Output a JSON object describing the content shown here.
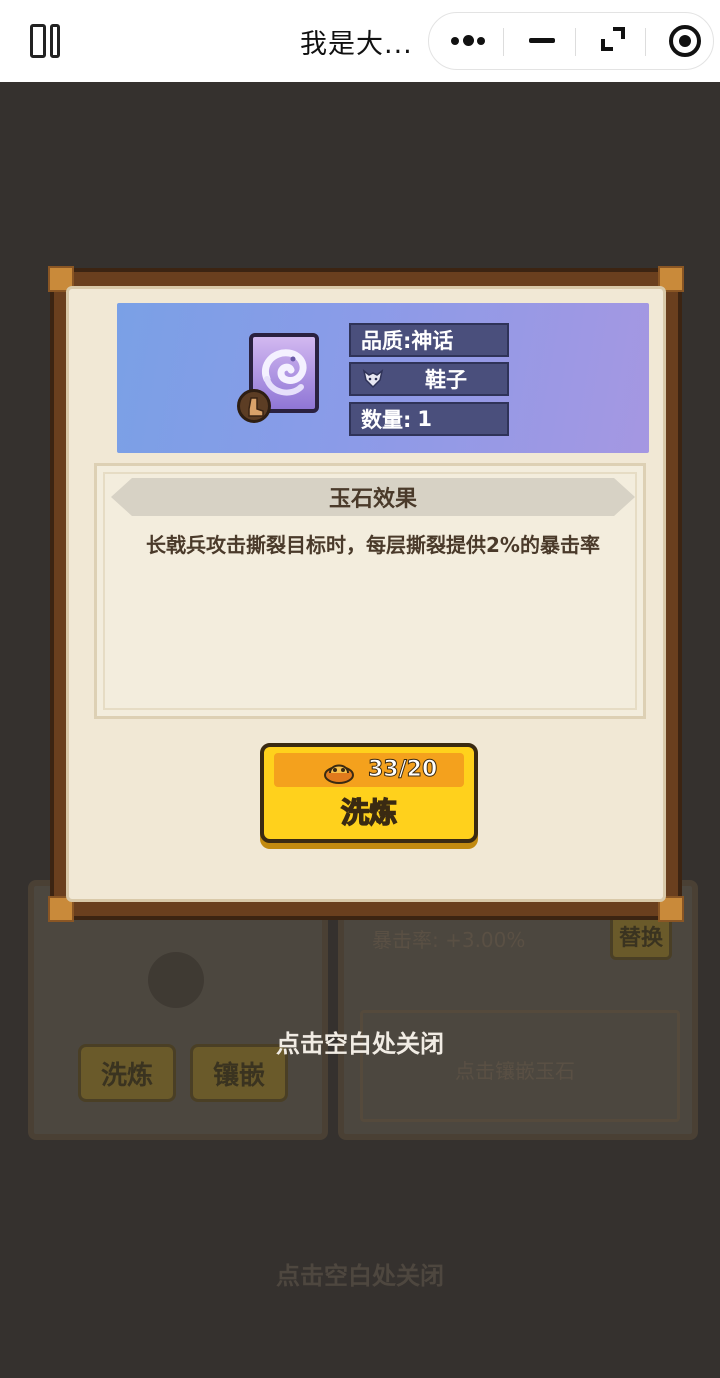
{
  "topbar": {
    "title": "我是大...",
    "icons": [
      "sidebar-icon",
      "more-icon",
      "minimize-icon",
      "restore-icon",
      "close-target-icon"
    ]
  },
  "background": {
    "refine_button": "洗炼",
    "inlay_button": "镶嵌",
    "crit_stat": "暴击率: +3.00%",
    "replace_button": "替换",
    "jade_hint": "点击镶嵌玉石",
    "close_hint": "点击空白处关闭"
  },
  "modal": {
    "quality_label": "品质:",
    "quality_value": "神话",
    "slot_name": "鞋子",
    "quantity_label": "数量:",
    "quantity_value": "1",
    "effect_title": "玉石效果",
    "effect_desc": "长戟兵攻击撕裂目标时，每层撕裂提供2%的暴击率",
    "cost": "33/20",
    "refine_label": "洗炼"
  },
  "close_hint": "点击空白处关闭",
  "colors": {
    "banner": "#8b9be8",
    "button": "#ffd11c",
    "cost_strip": "#f4a11d",
    "frame": "#6a3f1e"
  }
}
